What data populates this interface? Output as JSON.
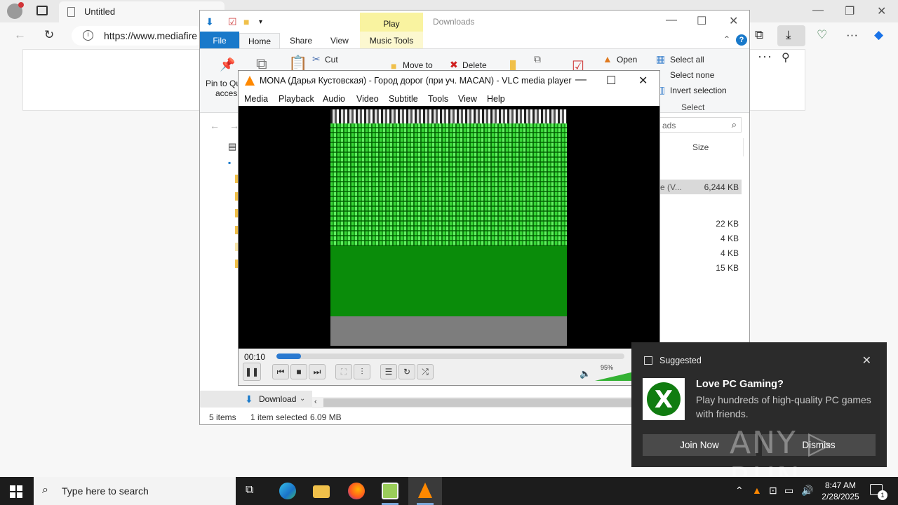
{
  "browser": {
    "tab_title": "Untitled",
    "url": "https://www.mediafire",
    "more_icon": "···",
    "pin_icon": "pin-icon"
  },
  "explorer": {
    "title": "Downloads",
    "play_tab": "Play",
    "tabs": {
      "file": "File",
      "home": "Home",
      "share": "Share",
      "view": "View",
      "music_tools": "Music Tools"
    },
    "ribbon": {
      "pin_label": "Pin to Qu",
      "access_label": "access",
      "cut": "Cut",
      "move_to": "Move to",
      "delete": "Delete",
      "open": "Open",
      "select_all": "Select all",
      "select_none": "Select none",
      "invert_selection": "Invert selection",
      "select_group": "Select"
    },
    "search_placeholder": "ads",
    "column_size": "Size",
    "selected_row_name": "e (V...",
    "selected_row_size": "6,244 KB",
    "sizes": [
      "22 KB",
      "4 KB",
      "4 KB",
      "15 KB"
    ],
    "nav_downloads": "Download",
    "status": {
      "items": "5 items",
      "selected": "1 item selected",
      "size": "6.09 MB"
    }
  },
  "vlc": {
    "title": "MONA (Дарья Кустовская) - Город дорог (при уч. MACAN) - VLC media player",
    "menu": [
      "Media",
      "Playback",
      "Audio",
      "Video",
      "Subtitle",
      "Tools",
      "View",
      "Help"
    ],
    "time": "00:10",
    "progress": 0.07,
    "volume": "95%"
  },
  "toast": {
    "header": "Suggested",
    "title": "Love PC Gaming?",
    "body": "Play hundreds of high-quality PC games with friends.",
    "join": "Join Now",
    "dismiss": "Dismiss",
    "logo_icon": "xbox-logo"
  },
  "watermark": "ANY ▷ RUN",
  "taskbar": {
    "search_placeholder": "Type here to search",
    "time": "8:47 AM",
    "date": "2/28/2025",
    "notification_count": "1"
  },
  "colors": {
    "accent": "#1979ca",
    "vlc_orange": "#ff8800",
    "xbox_green": "#107c10"
  }
}
